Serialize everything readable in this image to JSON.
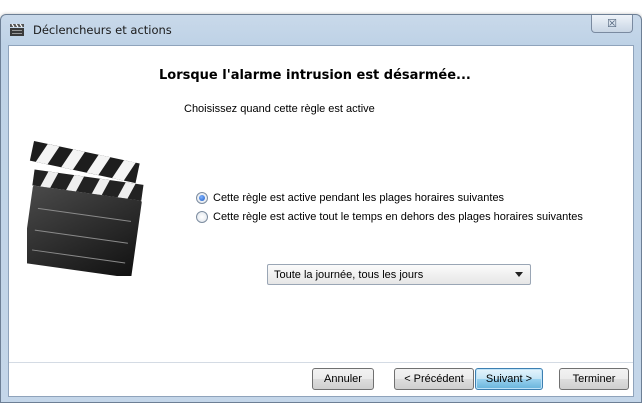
{
  "window": {
    "title": "Déclencheurs et actions",
    "close_glyph": "☒"
  },
  "main": {
    "heading": "Lorsque l'alarme intrusion est désarmée...",
    "subtitle": "Choisissez quand cette règle est active",
    "illustration": "clapperboard-icon"
  },
  "options": [
    {
      "label": "Cette règle est active pendant les plages horaires suivantes",
      "checked": true
    },
    {
      "label": "Cette règle est active tout le temps en dehors des plages horaires suivantes",
      "checked": false
    }
  ],
  "schedule_select": {
    "value": "Toute la journée, tous les jours"
  },
  "buttons": {
    "cancel": "Annuler",
    "previous": "< Précédent",
    "next": "Suivant >",
    "finish": "Terminer"
  },
  "colors": {
    "primary_button": "#98d1ef",
    "radio_checked": "#1c5bc4"
  }
}
